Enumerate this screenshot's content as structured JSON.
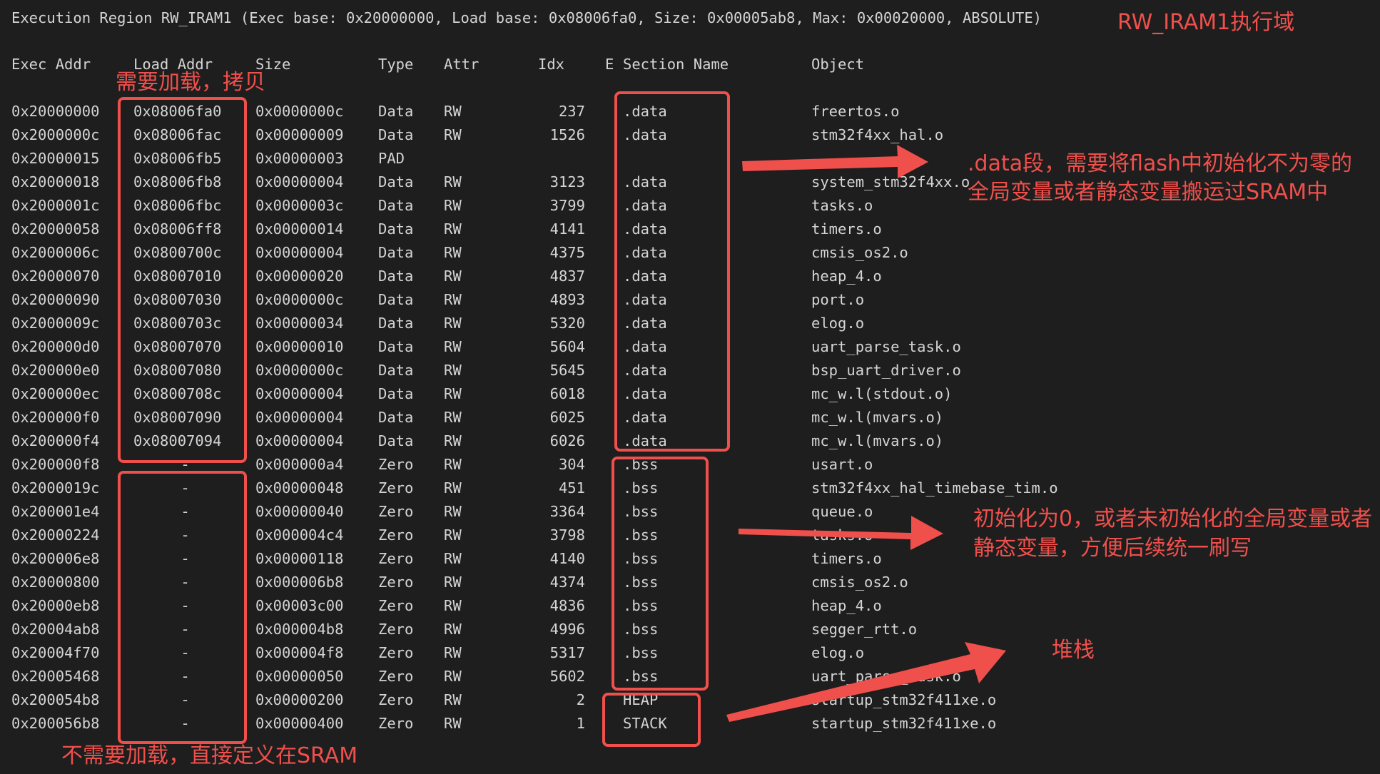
{
  "region_title": "Execution Region RW_IRAM1 (Exec base: 0x20000000, Load base: 0x08006fa0, Size: 0x00005ab8, Max: 0x00020000, ABSOLUTE)",
  "headers": {
    "exec_addr": "Exec Addr",
    "load_addr": "Load Addr",
    "size": "Size",
    "type": "Type",
    "attr": "Attr",
    "idx": "Idx",
    "e": "E",
    "section_name": "Section Name",
    "object": "Object"
  },
  "rows": [
    {
      "exec": "0x20000000",
      "load": "0x08006fa0",
      "size": "0x0000000c",
      "type": "Data",
      "attr": "RW",
      "idx": "237",
      "section": ".data",
      "object": "freertos.o"
    },
    {
      "exec": "0x2000000c",
      "load": "0x08006fac",
      "size": "0x00000009",
      "type": "Data",
      "attr": "RW",
      "idx": "1526",
      "section": ".data",
      "object": "stm32f4xx_hal.o"
    },
    {
      "exec": "0x20000015",
      "load": "0x08006fb5",
      "size": "0x00000003",
      "type": "PAD",
      "attr": "",
      "idx": "",
      "section": "",
      "object": ""
    },
    {
      "exec": "0x20000018",
      "load": "0x08006fb8",
      "size": "0x00000004",
      "type": "Data",
      "attr": "RW",
      "idx": "3123",
      "section": ".data",
      "object": "system_stm32f4xx.o"
    },
    {
      "exec": "0x2000001c",
      "load": "0x08006fbc",
      "size": "0x0000003c",
      "type": "Data",
      "attr": "RW",
      "idx": "3799",
      "section": ".data",
      "object": "tasks.o"
    },
    {
      "exec": "0x20000058",
      "load": "0x08006ff8",
      "size": "0x00000014",
      "type": "Data",
      "attr": "RW",
      "idx": "4141",
      "section": ".data",
      "object": "timers.o"
    },
    {
      "exec": "0x2000006c",
      "load": "0x0800700c",
      "size": "0x00000004",
      "type": "Data",
      "attr": "RW",
      "idx": "4375",
      "section": ".data",
      "object": "cmsis_os2.o"
    },
    {
      "exec": "0x20000070",
      "load": "0x08007010",
      "size": "0x00000020",
      "type": "Data",
      "attr": "RW",
      "idx": "4837",
      "section": ".data",
      "object": "heap_4.o"
    },
    {
      "exec": "0x20000090",
      "load": "0x08007030",
      "size": "0x0000000c",
      "type": "Data",
      "attr": "RW",
      "idx": "4893",
      "section": ".data",
      "object": "port.o"
    },
    {
      "exec": "0x2000009c",
      "load": "0x0800703c",
      "size": "0x00000034",
      "type": "Data",
      "attr": "RW",
      "idx": "5320",
      "section": ".data",
      "object": "elog.o"
    },
    {
      "exec": "0x200000d0",
      "load": "0x08007070",
      "size": "0x00000010",
      "type": "Data",
      "attr": "RW",
      "idx": "5604",
      "section": ".data",
      "object": "uart_parse_task.o"
    },
    {
      "exec": "0x200000e0",
      "load": "0x08007080",
      "size": "0x0000000c",
      "type": "Data",
      "attr": "RW",
      "idx": "5645",
      "section": ".data",
      "object": "bsp_uart_driver.o"
    },
    {
      "exec": "0x200000ec",
      "load": "0x0800708c",
      "size": "0x00000004",
      "type": "Data",
      "attr": "RW",
      "idx": "6018",
      "section": ".data",
      "object": "mc_w.l(stdout.o)"
    },
    {
      "exec": "0x200000f0",
      "load": "0x08007090",
      "size": "0x00000004",
      "type": "Data",
      "attr": "RW",
      "idx": "6025",
      "section": ".data",
      "object": "mc_w.l(mvars.o)"
    },
    {
      "exec": "0x200000f4",
      "load": "0x08007094",
      "size": "0x00000004",
      "type": "Data",
      "attr": "RW",
      "idx": "6026",
      "section": ".data",
      "object": "mc_w.l(mvars.o)"
    },
    {
      "exec": "0x200000f8",
      "load": "-",
      "size": "0x000000a4",
      "type": "Zero",
      "attr": "RW",
      "idx": "304",
      "section": ".bss",
      "object": "usart.o"
    },
    {
      "exec": "0x2000019c",
      "load": "-",
      "size": "0x00000048",
      "type": "Zero",
      "attr": "RW",
      "idx": "451",
      "section": ".bss",
      "object": "stm32f4xx_hal_timebase_tim.o"
    },
    {
      "exec": "0x200001e4",
      "load": "-",
      "size": "0x00000040",
      "type": "Zero",
      "attr": "RW",
      "idx": "3364",
      "section": ".bss",
      "object": "queue.o"
    },
    {
      "exec": "0x20000224",
      "load": "-",
      "size": "0x000004c4",
      "type": "Zero",
      "attr": "RW",
      "idx": "3798",
      "section": ".bss",
      "object": "tasks.o"
    },
    {
      "exec": "0x200006e8",
      "load": "-",
      "size": "0x00000118",
      "type": "Zero",
      "attr": "RW",
      "idx": "4140",
      "section": ".bss",
      "object": "timers.o"
    },
    {
      "exec": "0x20000800",
      "load": "-",
      "size": "0x000006b8",
      "type": "Zero",
      "attr": "RW",
      "idx": "4374",
      "section": ".bss",
      "object": "cmsis_os2.o"
    },
    {
      "exec": "0x20000eb8",
      "load": "-",
      "size": "0x00003c00",
      "type": "Zero",
      "attr": "RW",
      "idx": "4836",
      "section": ".bss",
      "object": "heap_4.o"
    },
    {
      "exec": "0x20004ab8",
      "load": "-",
      "size": "0x000004b8",
      "type": "Zero",
      "attr": "RW",
      "idx": "4996",
      "section": ".bss",
      "object": "segger_rtt.o"
    },
    {
      "exec": "0x20004f70",
      "load": "-",
      "size": "0x000004f8",
      "type": "Zero",
      "attr": "RW",
      "idx": "5317",
      "section": ".bss",
      "object": "elog.o"
    },
    {
      "exec": "0x20005468",
      "load": "-",
      "size": "0x00000050",
      "type": "Zero",
      "attr": "RW",
      "idx": "5602",
      "section": ".bss",
      "object": "uart_parse_task.o"
    },
    {
      "exec": "0x200054b8",
      "load": "-",
      "size": "0x00000200",
      "type": "Zero",
      "attr": "RW",
      "idx": "2",
      "section": "HEAP",
      "object": "startup_stm32f411xe.o"
    },
    {
      "exec": "0x200056b8",
      "load": "-",
      "size": "0x00000400",
      "type": "Zero",
      "attr": "RW",
      "idx": "1",
      "section": "STACK",
      "object": "startup_stm32f411xe.o"
    }
  ],
  "annotations": {
    "rw_iram1": "RW_IRAM1执行域",
    "need_load": "需要加载，拷贝",
    "data_note_line1": ".data段，需要将flash中初始化不为零的",
    "data_note_line2": "全局变量或者静态变量搬运过SRAM中",
    "bss_note_line1": "初始化为0，或者未初始化的全局变量或者",
    "bss_note_line2": "静态变量，方便后续统一刷写",
    "stack_note": "堆栈",
    "no_load": "不需要加载，直接定义在SRAM"
  },
  "colors": {
    "background": "#1e1e1e",
    "text": "#d4d4d4",
    "annotation": "#f0504c"
  }
}
